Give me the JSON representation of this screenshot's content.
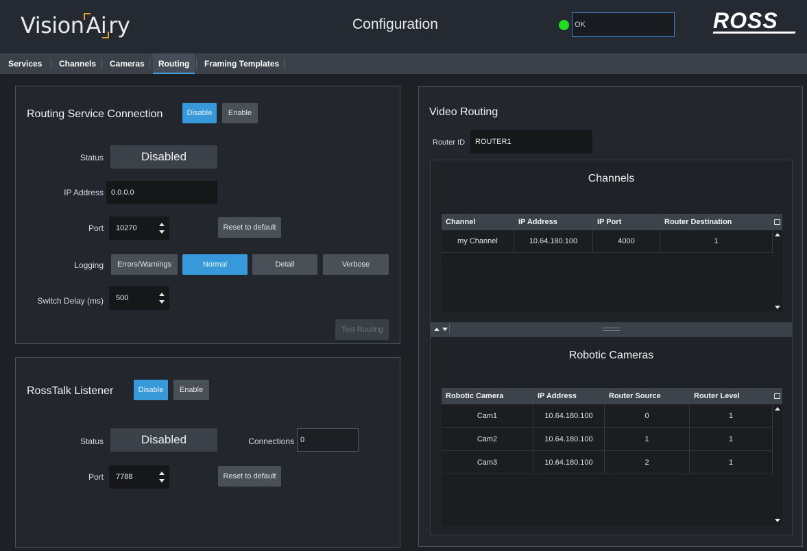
{
  "header": {
    "logo_pre": "Vision",
    "logo_mid": "Ai",
    "logo_post": "ry",
    "title": "Configuration",
    "status_text": "OK",
    "brand": "ROSS"
  },
  "tabs": [
    "Services",
    "Channels",
    "Cameras",
    "Routing",
    "Framing Templates"
  ],
  "routing_service": {
    "title": "Routing Service Connection",
    "disable": "Disable",
    "enable": "Enable",
    "status_label": "Status",
    "status_value": "Disabled",
    "ip_label": "IP Address",
    "ip_value": "0.0.0.0",
    "port_label": "Port",
    "port_value": "10270",
    "reset": "Reset to default",
    "logging_label": "Logging",
    "logging_options": [
      "Errors/Warnings",
      "Normal",
      "Detail",
      "Verbose"
    ],
    "delay_label": "Switch Delay (ms)",
    "delay_value": "500",
    "test": "Test Routing"
  },
  "rosstalk": {
    "title": "RossTalk Listener",
    "disable": "Disable",
    "enable": "Enable",
    "status_label": "Status",
    "status_value": "Disabled",
    "connections_label": "Connections",
    "connections_value": "0",
    "port_label": "Port",
    "port_value": "7788",
    "reset": "Reset to default"
  },
  "video_routing": {
    "title": "Video Routing",
    "router_id_label": "Router ID",
    "router_id_value": "ROUTER1",
    "channels": {
      "title": "Channels",
      "headers": [
        "Channel",
        "IP Address",
        "IP Port",
        "Router Destination"
      ],
      "rows": [
        [
          "my Channel",
          "10.64.180.100",
          "4000",
          "1"
        ]
      ]
    },
    "cameras": {
      "title": "Robotic Cameras",
      "headers": [
        "Robotic Camera",
        "IP Address",
        "Router Source",
        "Router Level"
      ],
      "rows": [
        [
          "Cam1",
          "10.64.180.100",
          "0",
          "1"
        ],
        [
          "Cam2",
          "10.64.180.100",
          "1",
          "1"
        ],
        [
          "Cam3",
          "10.64.180.100",
          "2",
          "1"
        ]
      ]
    }
  }
}
